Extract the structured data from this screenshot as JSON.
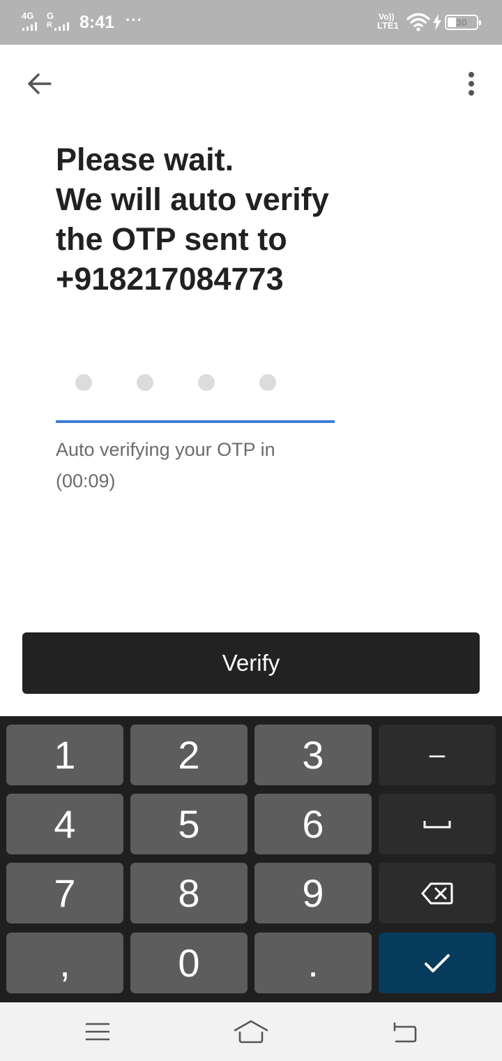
{
  "status_bar": {
    "network1_label": "4G",
    "network2_label": "G",
    "network2_sub": "R",
    "time": "8:41",
    "notification_dots": "···",
    "volte_line1": "Vo))",
    "volte_line2": "LTE1",
    "battery_level": "30",
    "battery_fraction": 0.3
  },
  "app_bar": {
    "back_icon": "arrow-back-icon",
    "more_icon": "more-vertical-icon"
  },
  "title_lines": [
    "Please wait.",
    "We will auto verify",
    "the OTP sent to",
    "+918217084773"
  ],
  "otp": {
    "digits_total": 4,
    "digits_filled": 0
  },
  "hint_lines": [
    "Auto verifying your OTP in",
    "(00:09)"
  ],
  "verify_button": {
    "label": "Verify"
  },
  "keyboard": {
    "keys": [
      "1",
      "2",
      "3",
      "–",
      "4",
      "5",
      "6",
      "space-icon",
      "7",
      "8",
      "9",
      "backspace-icon",
      ",",
      "0",
      ".",
      "check-icon"
    ]
  },
  "nav_bar": {
    "menu_icon": "menu-icon",
    "home_icon": "home-icon",
    "back_icon": "nav-back-icon"
  },
  "colors": {
    "status_bar_bg": "#b3b3b3",
    "accent_underline": "#3d7fd6",
    "verify_bg": "#222222",
    "keyboard_bg": "#1f1f1f",
    "key_bg": "#5d5d5d",
    "key_dark_bg": "#2c2c2c",
    "enter_key_bg": "#063b5c",
    "nav_bar_bg": "#f2f2f2"
  }
}
